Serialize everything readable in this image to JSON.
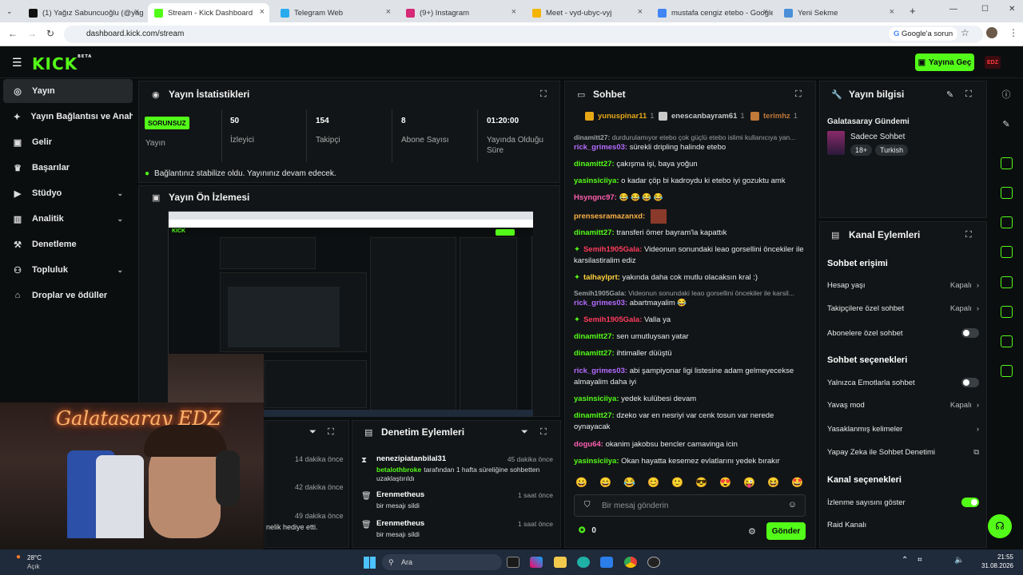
{
  "browser": {
    "tabs": [
      {
        "label": "(1) Yağız Sabuncuoğlu (@yago",
        "color": "#111111"
      },
      {
        "label": "Stream - Kick Dashboard",
        "color": "#53fc18"
      },
      {
        "label": "Telegram Web",
        "color": "#2aabee"
      },
      {
        "label": "(9+) Instagram",
        "color": "#d62976"
      },
      {
        "label": "Meet - vyd-ubyc-vyj",
        "color": "#f4b400"
      },
      {
        "label": "mustafa cengiz etebo - Google",
        "color": "#4285f4"
      },
      {
        "label": "Yeni Sekme",
        "color": "#4a90d9"
      }
    ],
    "url": "dashboard.kick.com/stream",
    "google_chip": "Google'a sorun"
  },
  "header": {
    "logo": "KICK",
    "beta": "BETA",
    "go_live": "Yayına Geç"
  },
  "sidebar": {
    "items": [
      {
        "label": "Yayın",
        "icon": "stream-icon",
        "active": true
      },
      {
        "label": "Yayın Bağlantısı ve Anahtarı",
        "icon": "key-icon"
      },
      {
        "label": "Gelir",
        "icon": "wallet-icon"
      },
      {
        "label": "Başarılar",
        "icon": "trophy-icon"
      },
      {
        "label": "Stüdyo",
        "icon": "studio-icon",
        "chevron": true
      },
      {
        "label": "Analitik",
        "icon": "chart-icon",
        "chevron": true
      },
      {
        "label": "Denetleme",
        "icon": "hammer-icon"
      },
      {
        "label": "Topluluk",
        "icon": "people-icon",
        "chevron": true
      },
      {
        "label": "Droplar ve ödüller",
        "icon": "gift-icon"
      }
    ]
  },
  "stats": {
    "title": "Yayın İstatistikleri",
    "status_badge": "SORUNSUZ",
    "status_label": "Yayın",
    "items": [
      {
        "value": "50",
        "label": "İzleyici"
      },
      {
        "value": "154",
        "label": "Takipçi"
      },
      {
        "value": "8",
        "label": "Abone Sayısı"
      },
      {
        "value": "01:20:00",
        "label": "Yayında Olduğu Süre"
      }
    ],
    "notice": "Bağlantınız stabilize oldu. Yayınınız devam edecek."
  },
  "preview": {
    "title": "Yayın Ön İzlemesi"
  },
  "webcam": {
    "neon_text": "Galatasaray EDZ"
  },
  "moderation": {
    "title": "Denetim Eylemleri",
    "left_times": [
      "14 dakika önce",
      "42 dakika önce",
      "49 dakika önce"
    ],
    "left_text": "nelik hediye etti.",
    "items": [
      {
        "user": "nenezipiatanbilal31",
        "time": "45 dakika önce",
        "actor": "betalothbroke",
        "detail": "tarafından 1 hafta süreliğine sohbetten uzaklaştırıldı"
      },
      {
        "user": "Erenmetheus",
        "time": "1 saat önce",
        "detail": "bir mesajı sildi"
      },
      {
        "user": "Erenmetheus",
        "time": "1 saat önce",
        "detail": "bir mesajı sildi"
      }
    ]
  },
  "chat": {
    "title": "Sohbet",
    "top_users": [
      {
        "name": "yunuspinar11",
        "rank": "1",
        "badge_color": "#e6a817"
      },
      {
        "name": "enescanbayram61",
        "rank": "1",
        "badge_color": "#c9c9c9"
      },
      {
        "name": "terimhz",
        "rank": "1",
        "badge_color": "#c07a3a"
      }
    ],
    "messages": [
      {
        "user": "dinamitt27:",
        "text": "durdurulamıyor etebo çok güçlü etebo islimi kullanıcıya yan...",
        "system": true
      },
      {
        "user": "rick_grimes03:",
        "text": "sürekli dripling halinde etebo",
        "color": "#b36bff"
      },
      {
        "user": "dinamitt27:",
        "text": "çakışma işi, baya yoğun",
        "color": "#53fc18"
      },
      {
        "user": "yasinsiciiya:",
        "text": "o kadar çöp bi kadroydu ki etebo iyi gozuktu amk",
        "color": "#53fc18"
      },
      {
        "user": "Hsyngnc97:",
        "text": "😂 😂 😂 😂",
        "color": "#ff5fb0"
      },
      {
        "user": "prensesramazanxd:",
        "text": "",
        "color": "#ffb347",
        "sticker": true
      },
      {
        "user": "dinamitt27:",
        "text": "transferi ömer bayram'la kapattık",
        "color": "#53fc18"
      },
      {
        "user": "Semih1905Gala:",
        "text": "Videonun sonundaki leao gorsellini öncekiler ile karsilastiralim ediz",
        "color": "#ff3b5c",
        "badge": true
      },
      {
        "user": "talhaylprt:",
        "text": "yakında daha cok mutlu olacaksın kral :)",
        "color": "#ffd23f",
        "badge": true
      },
      {
        "user": "Semih1905Gala:",
        "text": "Videonun sonundaki leao gorsellini öncekiler ile karsil...",
        "system": true
      },
      {
        "user": "rick_grimes03:",
        "text": "abartmayalim 😂",
        "color": "#b36bff"
      },
      {
        "user": "Semih1905Gala:",
        "text": "Valla ya",
        "color": "#ff3b5c",
        "badge": true
      },
      {
        "user": "dinamitt27:",
        "text": "sen umutluysan yatar",
        "color": "#53fc18"
      },
      {
        "user": "dinamitt27:",
        "text": "ihtimaller düüştü",
        "color": "#53fc18"
      },
      {
        "user": "rick_grimes03:",
        "text": "abi şampiyonar ligi listesine adam gelmeyecekse almayalim daha iyi",
        "color": "#b36bff"
      },
      {
        "user": "yasinsiciiya:",
        "text": "yedek kulübesi devam",
        "color": "#53fc18"
      },
      {
        "user": "dinamitt27:",
        "text": "dzeko var en nesriyi var cenk tosun var nerede oynayacak",
        "color": "#53fc18"
      },
      {
        "user": "dogu64:",
        "text": "okanim jakobsu bencler camavinga icin",
        "color": "#ff5fb0"
      },
      {
        "user": "yasinsiciiya:",
        "text": "Okan hayatta kesemez evlatlarını yedek bırakır",
        "color": "#53fc18"
      }
    ],
    "emotes": [
      "😀",
      "😄",
      "😂",
      "😊",
      "🙂",
      "😎",
      "😍",
      "😜",
      "😆",
      "🤩"
    ],
    "placeholder": "Bir mesaj gönderin",
    "points": "0",
    "send": "Gönder"
  },
  "stream_info": {
    "title": "Yayın bilgisi",
    "stream_title": "Galatasaray Gündemi",
    "category": "Sadece Sohbet",
    "tags": [
      "18+",
      "Turkish"
    ]
  },
  "channel_actions": {
    "title": "Kanal Eylemleri",
    "chat_access": "Sohbet erişimi",
    "account_age": {
      "label": "Hesap yaşı",
      "value": "Kapalı"
    },
    "followers_only": {
      "label": "Takipçilere özel sohbet",
      "value": "Kapalı"
    },
    "subs_only": {
      "label": "Abonelere özel sohbet"
    },
    "chat_options": "Sohbet seçenekleri",
    "emotes_only": {
      "label": "Yalnızca Emotlarla sohbet"
    },
    "slow_mode": {
      "label": "Yavaş mod",
      "value": "Kapalı"
    },
    "banned_words": {
      "label": "Yasaklanmış kelimeler"
    },
    "ai_mod": {
      "label": "Yapay Zeka ile Sohbet Denetimi"
    },
    "channel_options": "Kanal seçenekleri",
    "show_viewers": {
      "label": "İzlenme sayısını göster"
    },
    "raid": {
      "label": "Raid Kanalı"
    }
  },
  "taskbar": {
    "weather_temp": "28°C",
    "weather_desc": "Açık",
    "search": "Ara",
    "time": "21:55",
    "date": "31.08.2026"
  }
}
